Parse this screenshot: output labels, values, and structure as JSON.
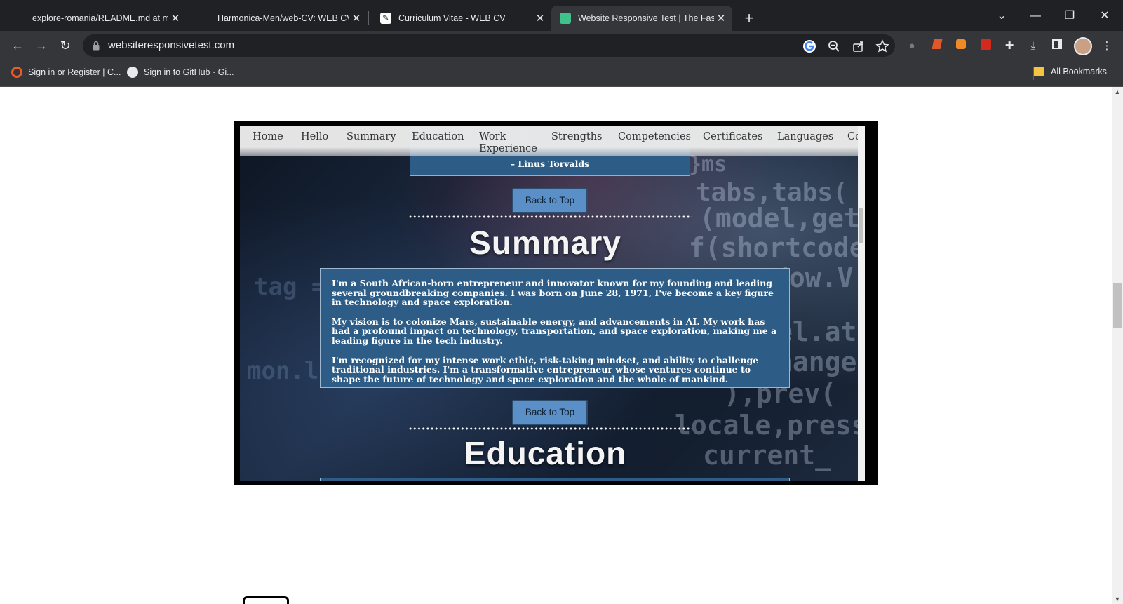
{
  "tabs": [
    {
      "title": "explore-romania/README.md at m",
      "close": "✕",
      "icon": "github-icon"
    },
    {
      "title": "Harmonica-Men/web-CV: WEB CV",
      "close": "✕",
      "icon": "github-icon"
    },
    {
      "title": "Curriculum Vitae - WEB CV",
      "close": "✕",
      "icon": "cv-icon"
    },
    {
      "title": "Website Responsive Test | The Faste",
      "close": "✕",
      "icon": "responsive-test-icon"
    }
  ],
  "window": {
    "new_tab": "+",
    "tab_search": "⌄",
    "minimize": "—",
    "restore": "❐",
    "close": "✕"
  },
  "toolbar": {
    "back": "←",
    "forward": "→",
    "reload": "↻",
    "url": "websiteresponsivetest.com",
    "menu": "⋮"
  },
  "bookmarks": {
    "items": [
      {
        "label": "Sign in or Register | C...",
        "icon": "site-icon"
      },
      {
        "label": "Sign in to GitHub · Gi...",
        "icon": "github-icon"
      }
    ],
    "all": "All Bookmarks"
  },
  "site": {
    "nav": [
      "Home",
      "Hello",
      "Summary",
      "Education",
      "Work Experience",
      "Strengths",
      "Competencies",
      "Certificates",
      "Languages",
      "Co"
    ],
    "quote_author": "– Linus Torvalds",
    "back_to_top": "Back to Top",
    "summary_title": "Summary",
    "summary_paragraphs": [
      "I'm a South African-born entrepreneur and innovator known for my founding and leading several groundbreaking companies. I was born on June 28, 1971, I've become a key figure in technology and space exploration.",
      "My vision is to colonize Mars, sustainable energy, and advancements in AI. My work has had a profound impact on technology, transportation, and space exploration, making me a leading figure in the tech industry.",
      "I'm recognized for my intense work ethic, risk-taking mindset, and ability to challenge traditional industries. I'm a transformative entrepreneur whose ventures continue to shape the future of technology and space exploration and the whole of mankind."
    ],
    "education_title": "Education"
  },
  "colors": {
    "accent_box": "#2d5d86",
    "button": "#5b8fc7",
    "chrome_dark": "#202124",
    "chrome": "#35363a"
  }
}
